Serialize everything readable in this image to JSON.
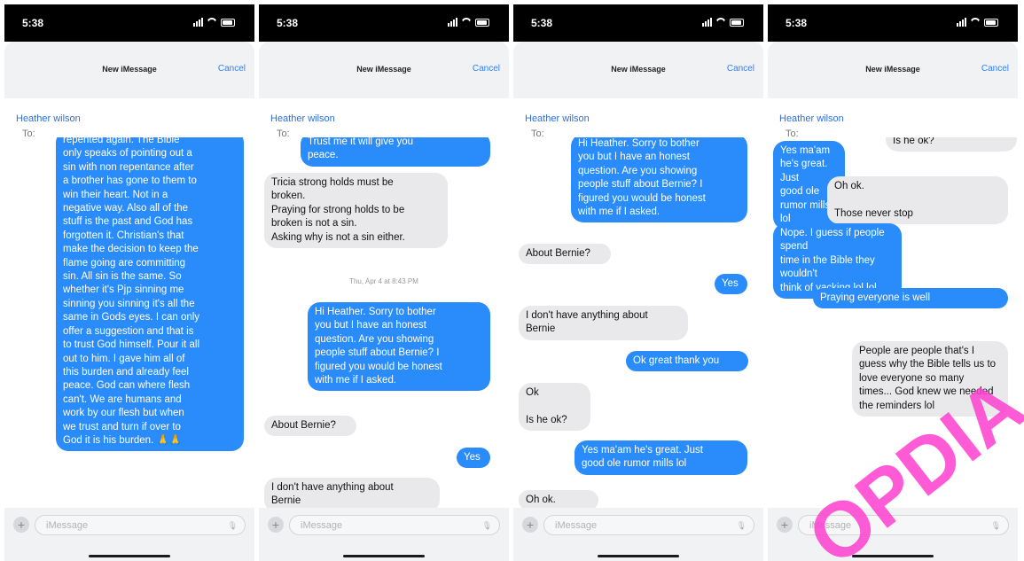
{
  "status_time": "5:38",
  "header": {
    "title": "New iMessage",
    "cancel_label": "Cancel"
  },
  "to": {
    "label": "To:",
    "name": "Heather wilson"
  },
  "composer": {
    "placeholder": "iMessage"
  },
  "colors": {
    "sent_bubble": "#2a8cfa",
    "received_bubble": "#e9e9eb",
    "link": "#2d7ff9"
  },
  "icons": {
    "add": "plus-icon",
    "mic": "mic-icon",
    "signal": "signal-icon",
    "wifi": "wifi-icon",
    "battery": "battery-icon"
  },
  "panels": [
    {
      "items": [
        {
          "type": "sent",
          "text": "repented again. The Bible\nonly speaks of pointing out a\nsin with non repentance after\na brother has gone to them to\nwin their heart. Not in a\nnegative way. Also all of the\nstuff is the past and God has\nforgotten it. Christian's that\nmake the decision to keep the\nflame going are committing\nsin. All sin is the same. So\nwhether it's Pjp sinning me\nsinning you sinning it's all the\nsame in Gods eyes. I can only\noffer a suggestion and that is\nto trust God himself. Pour it all\nout to him. I gave him all of\nthis burden and already feel\npeace. God can where flesh\ncan't. We are humans and\nwork by our flesh but when\nwe trust and turn if over to\nGod it is his burden. 🙏🙏"
        }
      ]
    },
    {
      "items": [
        {
          "type": "sent",
          "text": "Trust me it will give you\npeace."
        },
        {
          "type": "recv",
          "text": "Tricia strong holds must be\nbroken.\nPraying for strong holds to be\nbroken is not a sin.\nAsking why is not a sin either."
        },
        {
          "type": "stamp",
          "text": "Thu, Apr 4 at 8:43 PM"
        },
        {
          "type": "sent",
          "text": "Hi Heather. Sorry to bother\nyou but I have an honest\nquestion. Are you showing\npeople stuff about Bernie? I\nfigured you would be honest\nwith me if I asked."
        },
        {
          "type": "recv",
          "text": "About Bernie?"
        },
        {
          "type": "sent",
          "text": "Yes"
        },
        {
          "type": "recv",
          "text": "I don't have anything about\nBernie"
        }
      ]
    },
    {
      "items": [
        {
          "type": "sent",
          "text": "Hi Heather. Sorry to bother\nyou but I have an honest\nquestion. Are you showing\npeople stuff about Bernie? I\nfigured you would be honest\nwith me if I asked."
        },
        {
          "type": "recv",
          "text": "About Bernie?"
        },
        {
          "type": "sent",
          "text": "Yes"
        },
        {
          "type": "recv",
          "text": "I don't have anything about\nBernie"
        },
        {
          "type": "sent",
          "text": "Ok great thank you"
        },
        {
          "type": "recv",
          "text": "Ok\n\nIs he ok?"
        },
        {
          "type": "sent",
          "text": "Yes ma'am he's great. Just\ngood ole rumor mills lol"
        },
        {
          "type": "recv",
          "text": "Oh ok."
        }
      ]
    },
    {
      "items": [
        {
          "type": "recv",
          "text": "Ok\n\nIs he ok?"
        },
        {
          "type": "sent",
          "text": "Yes ma'am he's great. Just\ngood ole rumor mills lol"
        },
        {
          "type": "recv",
          "text": "Oh ok.\n\nThose never stop"
        },
        {
          "type": "sent",
          "text": "Nope. I guess if people spend\ntime in the Bible they wouldn't\nthink of yacking lol lol"
        },
        {
          "type": "sent",
          "text": "Praying everyone is well"
        },
        {
          "type": "recv",
          "text": "People are people that's I\nguess why the Bible tells us to\nlove everyone so many\ntimes... God knew we needed\nthe reminders lol"
        }
      ]
    }
  ]
}
